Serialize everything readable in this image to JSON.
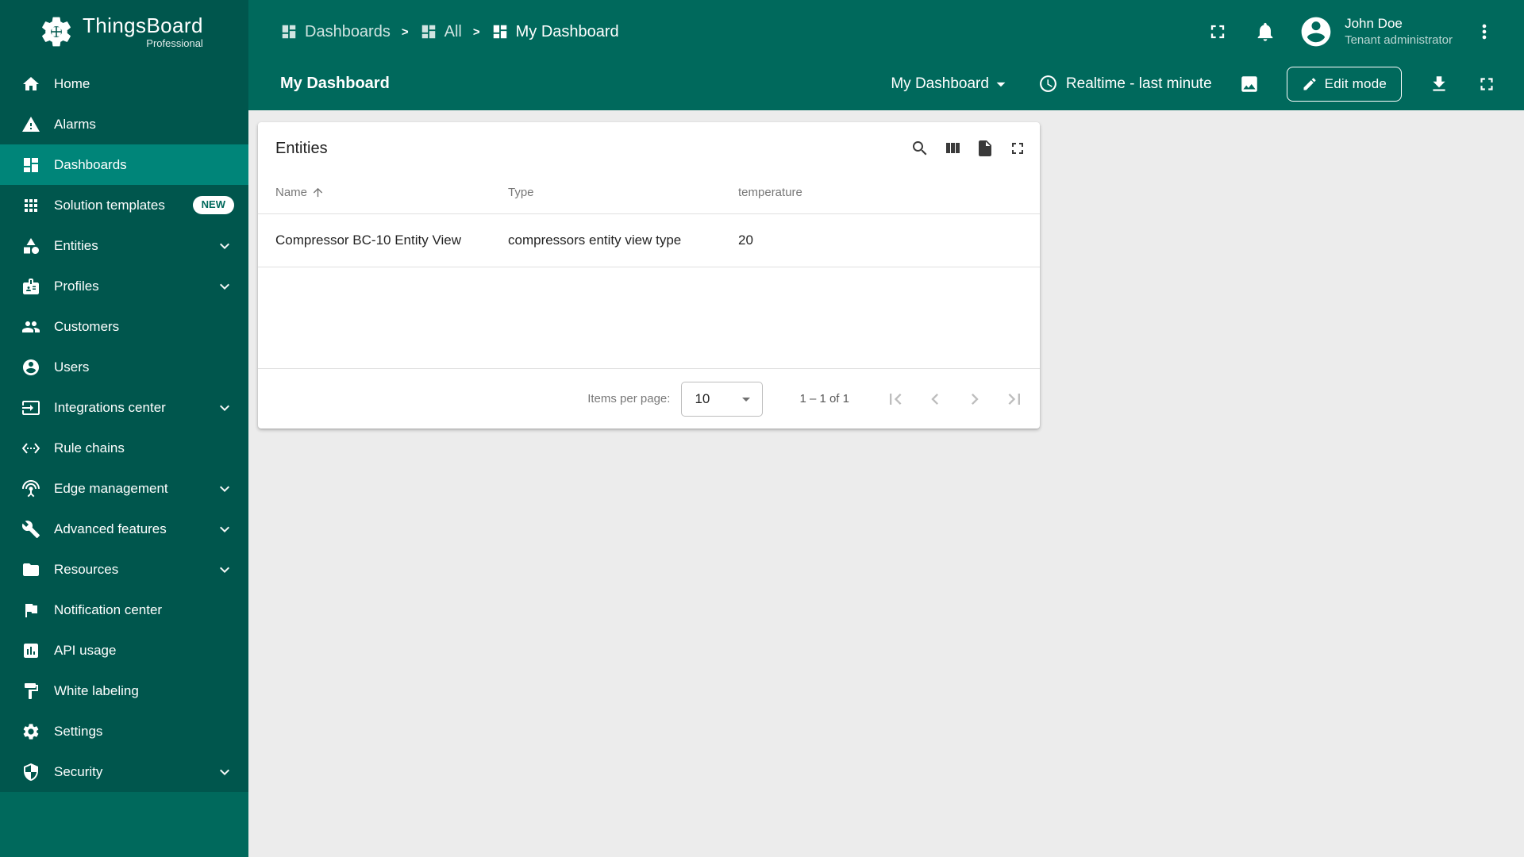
{
  "app": {
    "name": "ThingsBoard",
    "edition": "Professional"
  },
  "colors": {
    "sidebar_bg": "#00564d",
    "sidebar_bottom_bg": "#00695c",
    "header_bg": "#00695c",
    "active_item_bg": "#008579",
    "content_bg": "#ececec",
    "badge_bg": "#ffffff",
    "badge_text": "#00695c"
  },
  "sidebar": {
    "items": [
      {
        "label": "Home",
        "icon": "home-icon"
      },
      {
        "label": "Alarms",
        "icon": "warning-icon"
      },
      {
        "label": "Dashboards",
        "icon": "dashboards-icon",
        "active": true
      },
      {
        "label": "Solution templates",
        "icon": "apps-grid-icon",
        "badge": "NEW"
      },
      {
        "label": "Entities",
        "icon": "entities-icon",
        "expandable": true
      },
      {
        "label": "Profiles",
        "icon": "profiles-icon",
        "expandable": true
      },
      {
        "label": "Customers",
        "icon": "customers-icon"
      },
      {
        "label": "Users",
        "icon": "user-circle-icon"
      },
      {
        "label": "Integrations center",
        "icon": "integrations-icon",
        "expandable": true
      },
      {
        "label": "Rule chains",
        "icon": "rule-chains-icon"
      },
      {
        "label": "Edge management",
        "icon": "edge-antenna-icon",
        "expandable": true
      },
      {
        "label": "Advanced features",
        "icon": "tools-icon",
        "expandable": true
      },
      {
        "label": "Resources",
        "icon": "folder-icon",
        "expandable": true
      },
      {
        "label": "Notification center",
        "icon": "flag-icon"
      },
      {
        "label": "API usage",
        "icon": "chart-icon"
      },
      {
        "label": "White labeling",
        "icon": "paint-icon"
      },
      {
        "label": "Settings",
        "icon": "gear-icon"
      },
      {
        "label": "Security",
        "icon": "shield-icon",
        "expandable": true
      }
    ]
  },
  "breadcrumb": {
    "separator": ">",
    "items": [
      {
        "label": "Dashboards",
        "icon": "dashboards-icon"
      },
      {
        "label": "All",
        "icon": "dashboards-icon"
      },
      {
        "label": "My Dashboard",
        "icon": "dashboards-icon"
      }
    ]
  },
  "topbar": {
    "icons": [
      "fullscreen-icon",
      "bell-icon",
      "avatar",
      "more-vert-icon"
    ],
    "user_name": "John Doe",
    "user_role": "Tenant administrator"
  },
  "dashboard_toolbar": {
    "title": "My Dashboard",
    "dashboard_select_value": "My Dashboard",
    "timewindow": "Realtime - last minute",
    "icons": [
      "clock-icon",
      "image-icon",
      "download-icon",
      "fullscreen-icon"
    ],
    "edit_mode_label": "Edit mode"
  },
  "widget": {
    "title": "Entities",
    "actions": [
      "search-icon",
      "columns-icon",
      "export-file-icon",
      "fullscreen-icon"
    ],
    "table": {
      "columns": [
        {
          "label": "Name",
          "sorted": "asc"
        },
        {
          "label": "Type"
        },
        {
          "label": "temperature"
        }
      ],
      "rows": [
        {
          "name": "Compressor BC-10 Entity View",
          "type": "compressors entity view type",
          "temperature": "20"
        }
      ]
    },
    "paginator": {
      "items_per_page_label": "Items per page:",
      "items_per_page_value": "10",
      "range_label": "1 – 1 of 1",
      "buttons": [
        "first-page-icon",
        "prev-page-icon",
        "next-page-icon",
        "last-page-icon"
      ]
    }
  }
}
